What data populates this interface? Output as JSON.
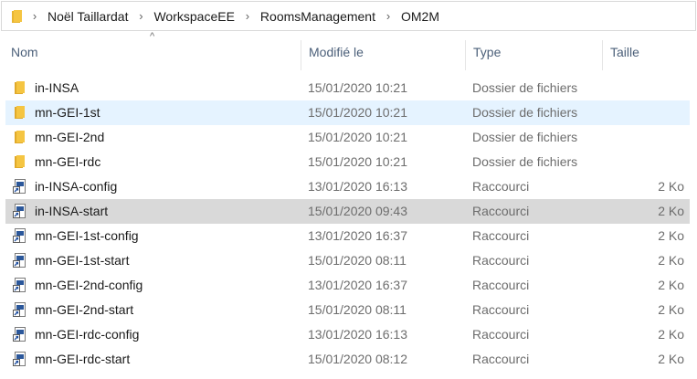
{
  "breadcrumb": {
    "segments": [
      "Noël Taillardat",
      "WorkspaceEE",
      "RoomsManagement",
      "OM2M"
    ],
    "separator": "›"
  },
  "columns": {
    "name": "Nom",
    "modified": "Modifié le",
    "type": "Type",
    "size": "Taille"
  },
  "sort_indicator": "^",
  "colors": {
    "folder": "#f5c542",
    "selected_light": "#e5f3ff",
    "selected_grey": "#d9d9d9",
    "header_text": "#4c607a"
  },
  "files": [
    {
      "name": "in-INSA",
      "modified": "15/01/2020 10:21",
      "type": "Dossier de fichiers",
      "size": "",
      "icon": "folder-icon",
      "state": "normal"
    },
    {
      "name": "mn-GEI-1st",
      "modified": "15/01/2020 10:21",
      "type": "Dossier de fichiers",
      "size": "",
      "icon": "folder-icon",
      "state": "hover"
    },
    {
      "name": "mn-GEI-2nd",
      "modified": "15/01/2020 10:21",
      "type": "Dossier de fichiers",
      "size": "",
      "icon": "folder-icon",
      "state": "normal"
    },
    {
      "name": "mn-GEI-rdc",
      "modified": "15/01/2020 10:21",
      "type": "Dossier de fichiers",
      "size": "",
      "icon": "folder-icon",
      "state": "normal"
    },
    {
      "name": "in-INSA-config",
      "modified": "13/01/2020 16:13",
      "type": "Raccourci",
      "size": "2 Ko",
      "icon": "shortcut-icon",
      "state": "normal"
    },
    {
      "name": "in-INSA-start",
      "modified": "15/01/2020 09:43",
      "type": "Raccourci",
      "size": "2 Ko",
      "icon": "shortcut-icon",
      "state": "selected"
    },
    {
      "name": "mn-GEI-1st-config",
      "modified": "13/01/2020 16:37",
      "type": "Raccourci",
      "size": "2 Ko",
      "icon": "shortcut-icon",
      "state": "normal"
    },
    {
      "name": "mn-GEI-1st-start",
      "modified": "15/01/2020 08:11",
      "type": "Raccourci",
      "size": "2 Ko",
      "icon": "shortcut-icon",
      "state": "normal"
    },
    {
      "name": "mn-GEI-2nd-config",
      "modified": "13/01/2020 16:37",
      "type": "Raccourci",
      "size": "2 Ko",
      "icon": "shortcut-icon",
      "state": "normal"
    },
    {
      "name": "mn-GEI-2nd-start",
      "modified": "15/01/2020 08:11",
      "type": "Raccourci",
      "size": "2 Ko",
      "icon": "shortcut-icon",
      "state": "normal"
    },
    {
      "name": "mn-GEI-rdc-config",
      "modified": "13/01/2020 16:13",
      "type": "Raccourci",
      "size": "2 Ko",
      "icon": "shortcut-icon",
      "state": "normal"
    },
    {
      "name": "mn-GEI-rdc-start",
      "modified": "15/01/2020 08:12",
      "type": "Raccourci",
      "size": "2 Ko",
      "icon": "shortcut-icon",
      "state": "normal"
    }
  ]
}
